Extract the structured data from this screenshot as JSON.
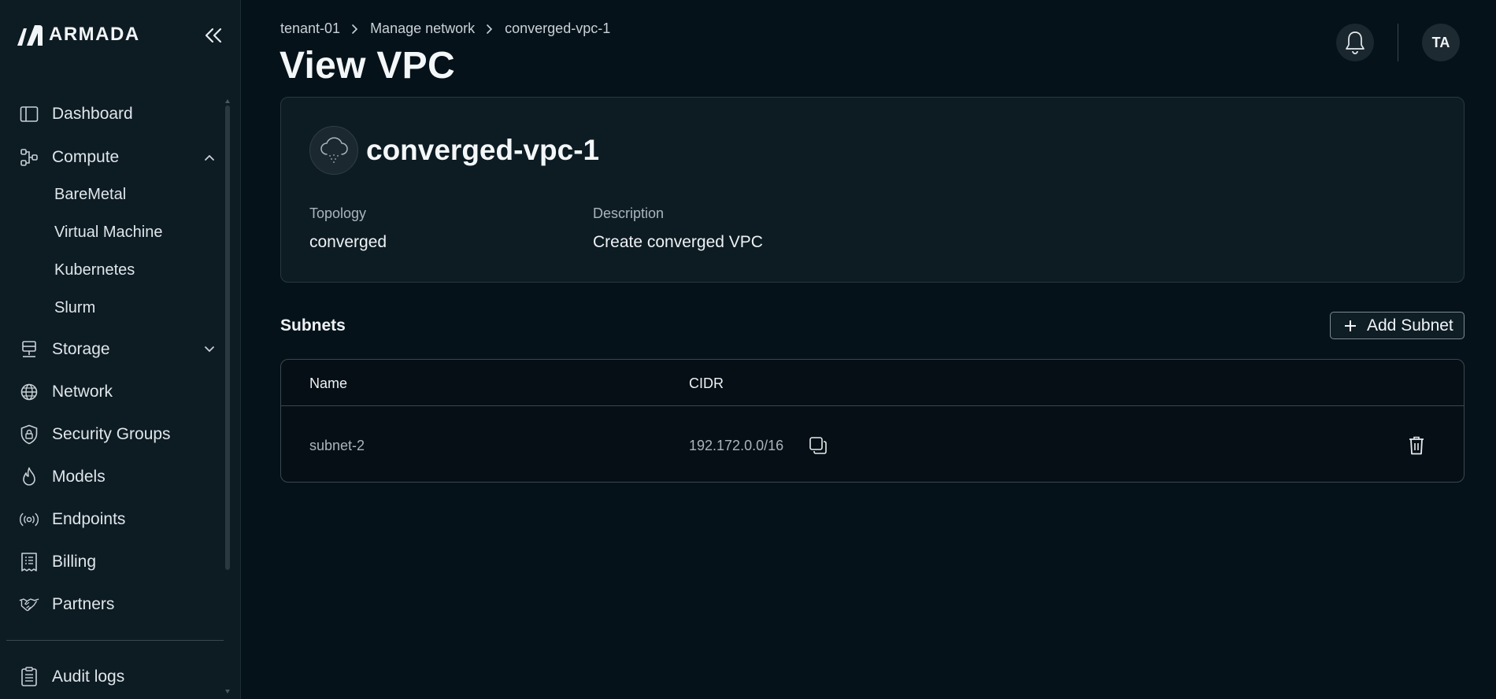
{
  "app": {
    "brand": "ARMADA",
    "collapse_icon": "double-chevron-left-icon"
  },
  "sidebar": {
    "items": [
      {
        "label": "Dashboard",
        "icon": "dashboard-icon"
      },
      {
        "label": "Compute",
        "icon": "compute-icon",
        "expanded": true
      },
      {
        "label": "BareMetal"
      },
      {
        "label": "Virtual Machine"
      },
      {
        "label": "Kubernetes"
      },
      {
        "label": "Slurm"
      },
      {
        "label": "Storage",
        "icon": "storage-icon",
        "expanded": false
      },
      {
        "label": "Network",
        "icon": "globe-icon"
      },
      {
        "label": "Security Groups",
        "icon": "shield-lock-icon"
      },
      {
        "label": "Models",
        "icon": "flame-icon"
      },
      {
        "label": "Endpoints",
        "icon": "broadcast-icon"
      },
      {
        "label": "Billing",
        "icon": "receipt-icon"
      },
      {
        "label": "Partners",
        "icon": "handshake-icon"
      },
      {
        "label": "Audit logs",
        "icon": "clipboard-icon"
      }
    ]
  },
  "header": {
    "breadcrumb": [
      "tenant-01",
      "Manage network",
      "converged-vpc-1"
    ],
    "title": "View VPC",
    "avatar_initials": "TA",
    "bell_icon": "bell-icon"
  },
  "vpc": {
    "name": "converged-vpc-1",
    "icon": "cloud-icon",
    "topology_label": "Topology",
    "topology_value": "converged",
    "description_label": "Description",
    "description_value": "Create converged VPC"
  },
  "subnets": {
    "title": "Subnets",
    "add_label": "Add Subnet",
    "columns": [
      "Name",
      "CIDR"
    ],
    "rows": [
      {
        "name": "subnet-2",
        "cidr": "192.172.0.0/16"
      }
    ]
  },
  "colors": {
    "background": "#06121a",
    "sidebar": "#0d1b23",
    "card": "#0d1b23",
    "border": "#2a3840"
  }
}
